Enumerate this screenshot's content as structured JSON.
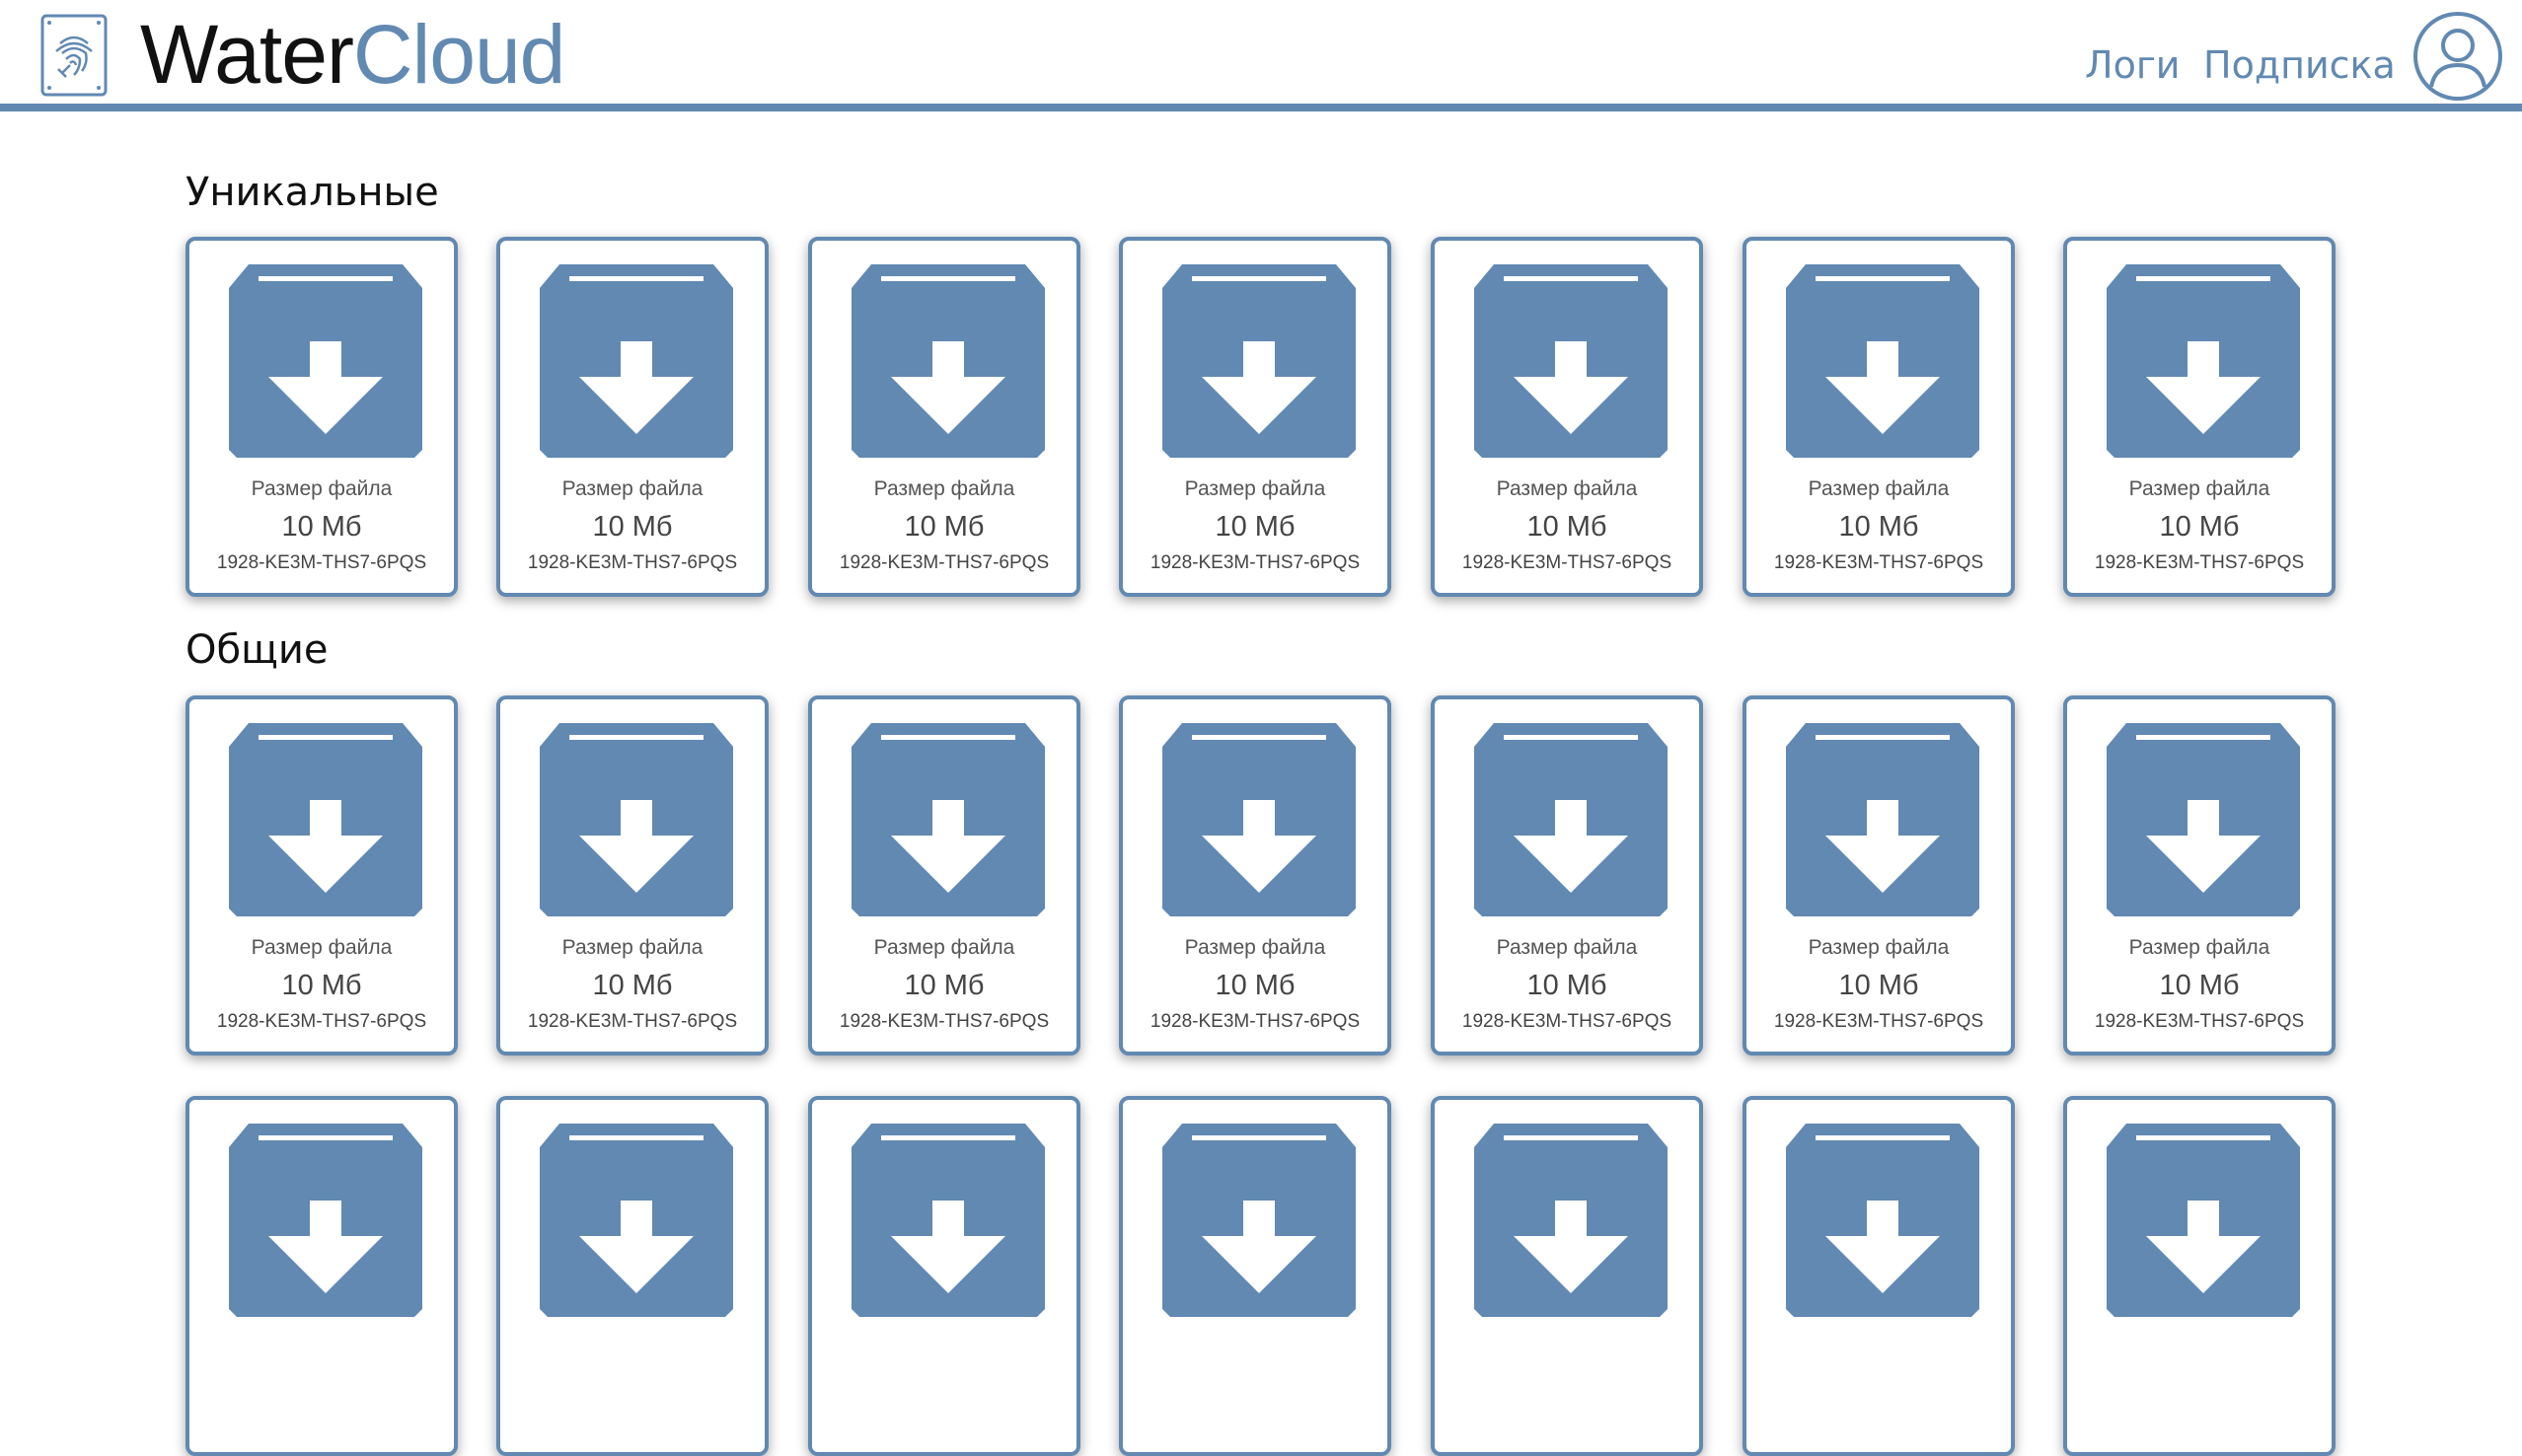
{
  "brand": {
    "part1": "Water",
    "part2": "Cloud"
  },
  "nav": {
    "logs": "Логи",
    "subscription": "Подписка"
  },
  "colors": {
    "accent": "#6189b2",
    "text": "#111111"
  },
  "icons": {
    "logo": "fingerprint-drive-icon",
    "avatar": "user-icon",
    "file": "archive-download-icon"
  },
  "sections": [
    {
      "title": "Уникальные",
      "files": [
        {
          "caption": "Размер файла",
          "size": "10 Мб",
          "code": "1928-KE3M-THS7-6PQS"
        },
        {
          "caption": "Размер файла",
          "size": "10 Мб",
          "code": "1928-KE3M-THS7-6PQS"
        },
        {
          "caption": "Размер файла",
          "size": "10 Мб",
          "code": "1928-KE3M-THS7-6PQS"
        },
        {
          "caption": "Размер файла",
          "size": "10 Мб",
          "code": "1928-KE3M-THS7-6PQS"
        },
        {
          "caption": "Размер файла",
          "size": "10 Мб",
          "code": "1928-KE3M-THS7-6PQS"
        },
        {
          "caption": "Размер файла",
          "size": "10 Мб",
          "code": "1928-KE3M-THS7-6PQS"
        },
        {
          "caption": "Размер файла",
          "size": "10 Мб",
          "code": "1928-KE3M-THS7-6PQS"
        }
      ]
    },
    {
      "title": "Общие",
      "files": [
        {
          "caption": "Размер файла",
          "size": "10 Мб",
          "code": "1928-KE3M-THS7-6PQS"
        },
        {
          "caption": "Размер файла",
          "size": "10 Мб",
          "code": "1928-KE3M-THS7-6PQS"
        },
        {
          "caption": "Размер файла",
          "size": "10 Мб",
          "code": "1928-KE3M-THS7-6PQS"
        },
        {
          "caption": "Размер файла",
          "size": "10 Мб",
          "code": "1928-KE3M-THS7-6PQS"
        },
        {
          "caption": "Размер файла",
          "size": "10 Мб",
          "code": "1928-KE3M-THS7-6PQS"
        },
        {
          "caption": "Размер файла",
          "size": "10 Мб",
          "code": "1928-KE3M-THS7-6PQS"
        },
        {
          "caption": "Размер файла",
          "size": "10 Мб",
          "code": "1928-KE3M-THS7-6PQS"
        }
      ],
      "more_files_count": 7
    }
  ]
}
